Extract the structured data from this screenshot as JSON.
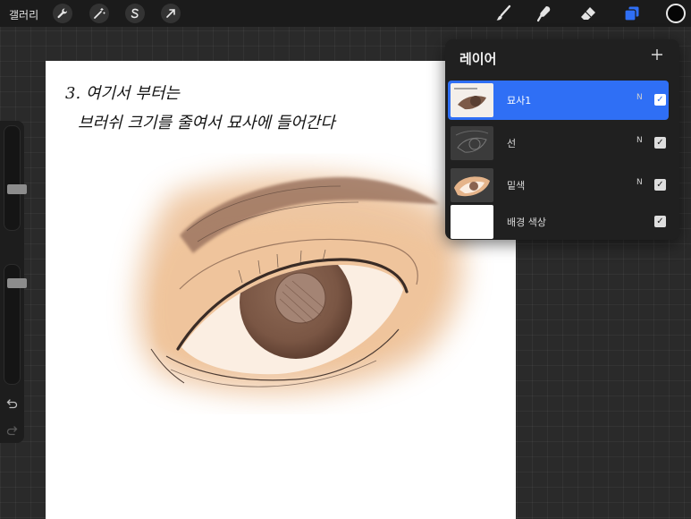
{
  "toolbar": {
    "gallery_label": "갤러리",
    "adjust_tools": [
      {
        "icon": "wrench-icon",
        "name": "actions-wrench-button"
      },
      {
        "icon": "magic-wand-icon",
        "name": "adjustments-wand-button"
      },
      {
        "icon": "selection-s-icon",
        "name": "selection-button"
      },
      {
        "icon": "arrow-cursor-icon",
        "name": "transform-button"
      }
    ],
    "paint_tools": [
      {
        "icon": "brush-icon",
        "name": "brush-tool-button"
      },
      {
        "icon": "smudge-icon",
        "name": "smudge-tool-button"
      },
      {
        "icon": "eraser-icon",
        "name": "eraser-tool-button"
      },
      {
        "icon": "layers-icon",
        "name": "layers-button"
      }
    ],
    "accent_color": "#2f6ff5",
    "current_color": "#050505"
  },
  "sidebar": {
    "brush_size_level": 0.38,
    "opacity_level": 0.88,
    "undo_icon": "undo-icon",
    "redo_icon": "redo-icon"
  },
  "canvas": {
    "note_line1": "3. 여기서 부터는",
    "note_line2": "브러쉬 크기를 줄여서 묘사에 들어간다"
  },
  "layers_panel": {
    "title": "레이어",
    "add_icon": "plus-icon",
    "layers": [
      {
        "name": "묘사1",
        "blend": "N",
        "visible": true,
        "active": true
      },
      {
        "name": "선",
        "blend": "N",
        "visible": true,
        "active": false
      },
      {
        "name": "밑색",
        "blend": "N",
        "visible": true,
        "active": false
      },
      {
        "name": "배경 색상",
        "blend": "",
        "visible": true,
        "active": false
      }
    ]
  }
}
